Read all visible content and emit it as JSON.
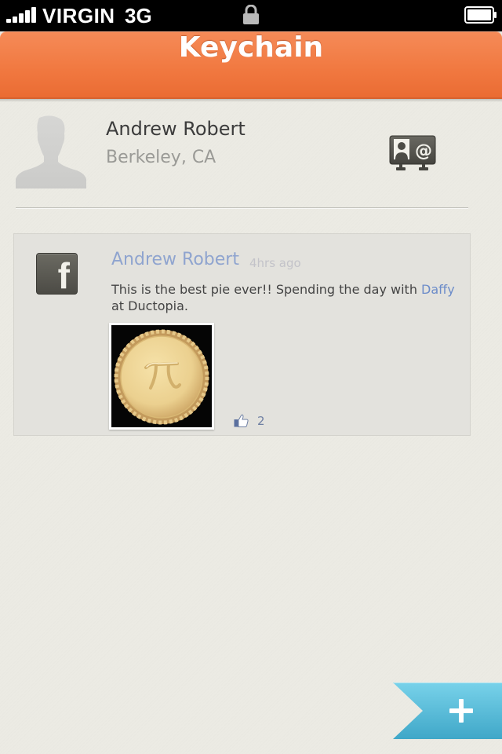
{
  "status_bar": {
    "carrier": "VIRGIN",
    "network": "3G"
  },
  "nav": {
    "title": "Keychain",
    "accent_color": "#f17941"
  },
  "profile": {
    "name": "Andrew Robert",
    "location": "Berkeley, CA"
  },
  "feed": {
    "items": [
      {
        "source_icon": "facebook-icon",
        "author": "Andrew Robert",
        "time": "4hrs ago",
        "text_before": "This is the best pie ever!! Spending the day with ",
        "mention": "Daffy",
        "text_after": " at Ductopia.",
        "photo_icon": "pie-photo",
        "likes": "2"
      }
    ]
  },
  "add_button": {
    "icon": "plus-icon",
    "color": "#58c0dc"
  }
}
